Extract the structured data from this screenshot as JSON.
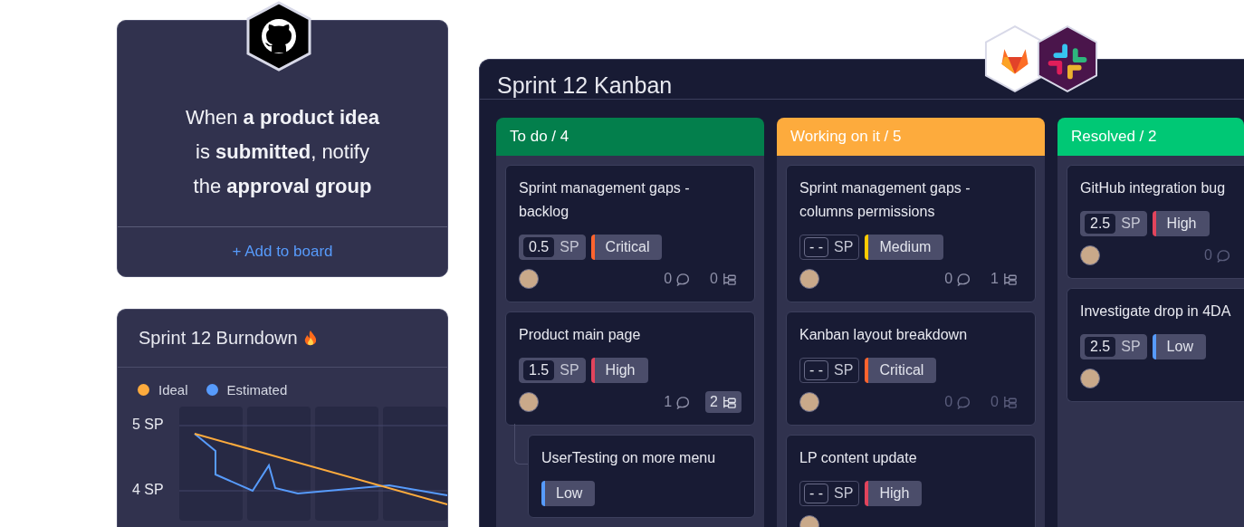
{
  "automation": {
    "sentence": "When **a product idea**\nis **submitted**, notify\nthe **approval group**",
    "action": "+ Add to board"
  },
  "burndown": {
    "title": "Sprint 12 Burndown",
    "legend": [
      {
        "label": "Ideal",
        "color": "#fdab3d"
      },
      {
        "label": "Estimated",
        "color": "#579bfc"
      }
    ],
    "y_labels": [
      "5 SP",
      "4 SP"
    ]
  },
  "kanban": {
    "title": "Sprint 12 Kanban",
    "columns": [
      {
        "title": "To do / 4",
        "color": "#037f4c",
        "cards": [
          {
            "title": "Sprint management gaps - backlog",
            "sp": "0.5",
            "sp_unit": "SP",
            "estimated": true,
            "priority": {
              "label": "Critical",
              "color": "#ff642e"
            },
            "comments": "0",
            "subtasks": "0",
            "subtasks_open": false,
            "counts_dimmed": false
          },
          {
            "title": "Product main page",
            "sp": "1.5",
            "sp_unit": "SP",
            "estimated": true,
            "priority": {
              "label": "High",
              "color": "#e2445c"
            },
            "comments": "1",
            "subtasks": "2",
            "subtasks_open": true,
            "counts_dimmed": false,
            "children": [
              {
                "title": "UserTesting on more menu",
                "priority": {
                  "label": "Low",
                  "color": "#579bfc"
                }
              }
            ]
          }
        ]
      },
      {
        "title": "Working on it / 5",
        "color": "#fdab3d",
        "cards": [
          {
            "title": "Sprint management gaps - columns permissions",
            "sp": "- -",
            "sp_unit": "SP",
            "estimated": false,
            "priority": {
              "label": "Medium",
              "color": "#ffcb00"
            },
            "comments": "0",
            "subtasks": "1",
            "subtasks_open": false,
            "counts_dimmed": false
          },
          {
            "title": "Kanban layout breakdown",
            "sp": "- -",
            "sp_unit": "SP",
            "estimated": false,
            "priority": {
              "label": "Critical",
              "color": "#ff642e"
            },
            "comments": "0",
            "subtasks": "0",
            "subtasks_open": false,
            "counts_dimmed": true
          },
          {
            "title": "LP content update",
            "sp": "- -",
            "sp_unit": "SP",
            "estimated": false,
            "priority": {
              "label": "High",
              "color": "#e2445c"
            }
          }
        ]
      },
      {
        "title": "Resolved / 2",
        "color": "#00c875",
        "cards": [
          {
            "title": "GitHub integration bug",
            "sp": "2.5",
            "sp_unit": "SP",
            "estimated": true,
            "priority": {
              "label": "High",
              "color": "#e2445c"
            },
            "comments": "0",
            "counts_dimmed": true
          },
          {
            "title": "Investigate drop in 4DA",
            "sp": "2.5",
            "sp_unit": "SP",
            "estimated": true,
            "priority": {
              "label": "Low",
              "color": "#579bfc"
            }
          }
        ]
      }
    ]
  }
}
